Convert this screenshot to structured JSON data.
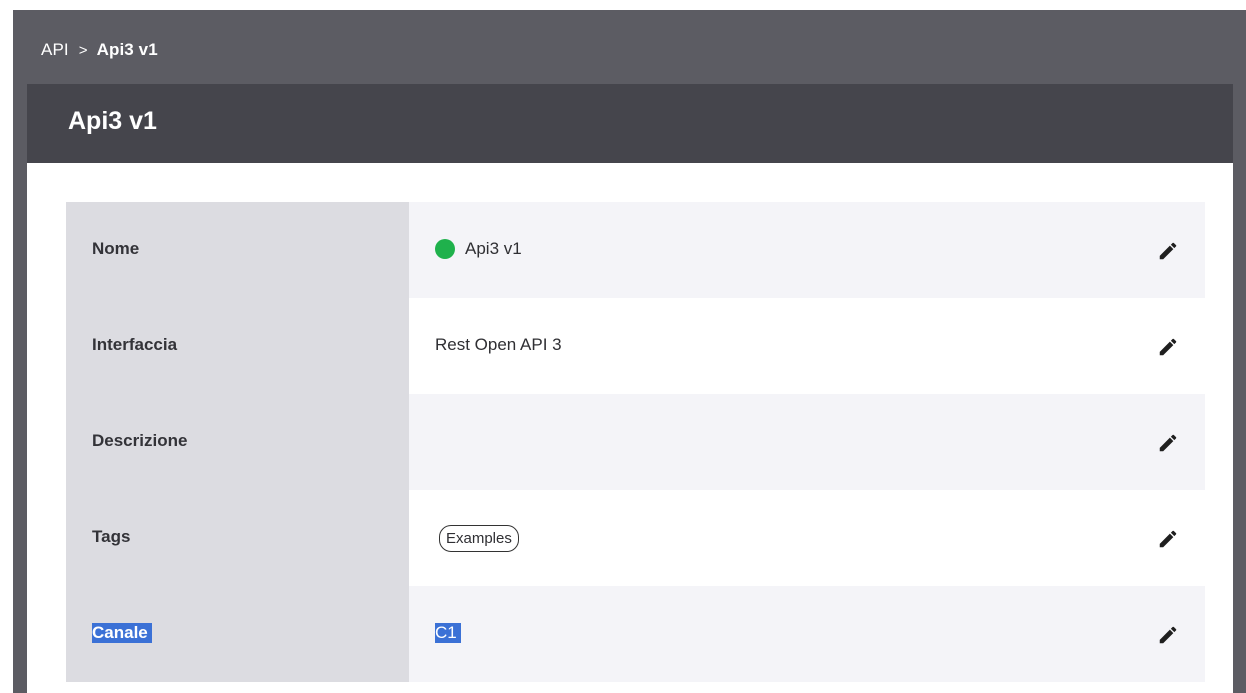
{
  "breadcrumb": {
    "root": "API",
    "separator": ">",
    "current": "Api3 v1"
  },
  "page": {
    "title": "Api3 v1"
  },
  "details": {
    "rows": [
      {
        "label": "Nome",
        "value": "Api3 v1",
        "status_color": "#1fb14c",
        "edit_icon": "pencil-icon"
      },
      {
        "label": "Interfaccia",
        "value": "Rest Open API 3",
        "edit_icon": "pencil-icon"
      },
      {
        "label": "Descrizione",
        "value": "",
        "edit_icon": "pencil-icon"
      },
      {
        "label": "Tags",
        "tags": [
          "Examples"
        ],
        "edit_icon": "pencil-icon"
      },
      {
        "label": "Canale",
        "value": "C1",
        "edit_icon": "pencil-icon",
        "selected": true
      }
    ]
  },
  "colors": {
    "topbar": "#5c5c63",
    "title_bar": "#45454c",
    "label_column": "#dcdce1",
    "status_active": "#1fb14c",
    "selection": "#3b71d6"
  }
}
